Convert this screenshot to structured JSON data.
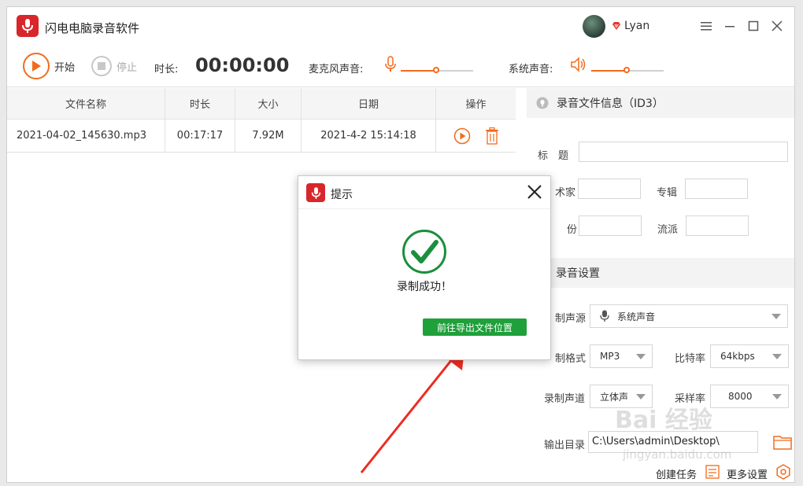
{
  "app": {
    "title": "闪电电脑录音软件",
    "username": "Lyan"
  },
  "toolbar": {
    "start_label": "开始",
    "stop_label": "停止",
    "duration_label": "时长:",
    "timer": "00:00:00",
    "mic_label": "麦克风声音:",
    "system_label": "系统声音:",
    "mic_volume": 0.5,
    "system_volume": 0.5,
    "accent_color": "#f26b1d"
  },
  "table": {
    "headers": [
      "文件名称",
      "时长",
      "大小",
      "日期",
      "操作"
    ],
    "rows": [
      {
        "name": "2021-04-02_145630.mp3",
        "duration": "00:17:17",
        "size": "7.92M",
        "date": "2021-4-2  15:14:18"
      }
    ]
  },
  "id3": {
    "section_title": "录音文件信息（ID3）",
    "title_label": "标　题",
    "artist_label": "术家",
    "album_label": "专辑",
    "year_label": "份",
    "genre_label": "流派"
  },
  "settings": {
    "section_title": "录音设置",
    "source_label": "制声源",
    "source_value": "系统声音",
    "format_label": "制格式",
    "format_value": "MP3",
    "bitrate_label": "比特率",
    "bitrate_value": "64kbps",
    "channel_label": "录制声道",
    "channel_value": "立体声",
    "samplerate_label": "采样率",
    "samplerate_value": "8000",
    "output_label": "输出目录",
    "output_value": "C:\\Users\\admin\\Desktop\\",
    "create_task_label": "创建任务",
    "more_settings_label": "更多设置"
  },
  "modal": {
    "title": "提示",
    "message": "录制成功！",
    "button_label": "前往导出文件位置",
    "success_color": "#1a8f3c",
    "button_color": "#1fa03a"
  },
  "watermark": {
    "text": "Bai 经验",
    "subtext": "jingyan.baidu.com"
  }
}
